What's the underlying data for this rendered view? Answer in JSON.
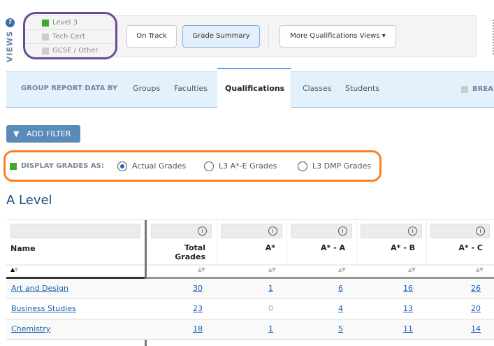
{
  "views": {
    "label": "VIEWS",
    "help_icon": "question-circle-icon"
  },
  "levels": [
    {
      "label": "Level 3",
      "color": "#3faa2a"
    },
    {
      "label": "Tech Cert",
      "color": "#cccccc"
    },
    {
      "label": "GCSE / Other",
      "color": "#cccccc"
    }
  ],
  "view_buttons": {
    "on_track": "On Track",
    "grade_summary": "Grade Summary",
    "more": "More Qualifications Views ▾"
  },
  "group_by": {
    "label": "GROUP REPORT DATA BY",
    "tabs": [
      "Groups",
      "Faculties",
      "Qualifications",
      "Classes",
      "Students"
    ],
    "active": "Qualifications",
    "break_label": "BREAK"
  },
  "add_filter": "ADD FILTER",
  "display_grades": {
    "label": "DISPLAY GRADES AS:",
    "options": [
      "Actual Grades",
      "L3 A*-E Grades",
      "L3 DMP Grades"
    ],
    "selected": "Actual Grades"
  },
  "section_title": "A Level",
  "table": {
    "columns": [
      "Name",
      "Total Grades",
      "A*",
      "A* - A",
      "A* - B",
      "A* - C"
    ],
    "rows": [
      {
        "name": "Art and Design",
        "values": [
          "30",
          "1",
          "6",
          "16",
          "26"
        ]
      },
      {
        "name": "Business Studies",
        "values": [
          "23",
          "0",
          "4",
          "13",
          "20"
        ]
      },
      {
        "name": "Chemistry",
        "values": [
          "18",
          "1",
          "5",
          "11",
          "14"
        ]
      }
    ]
  },
  "colors": {
    "accent": "#5a8ab8",
    "link": "#1a5fb4",
    "highlight_purple": "#6a4c93",
    "highlight_orange": "#f5822a"
  }
}
